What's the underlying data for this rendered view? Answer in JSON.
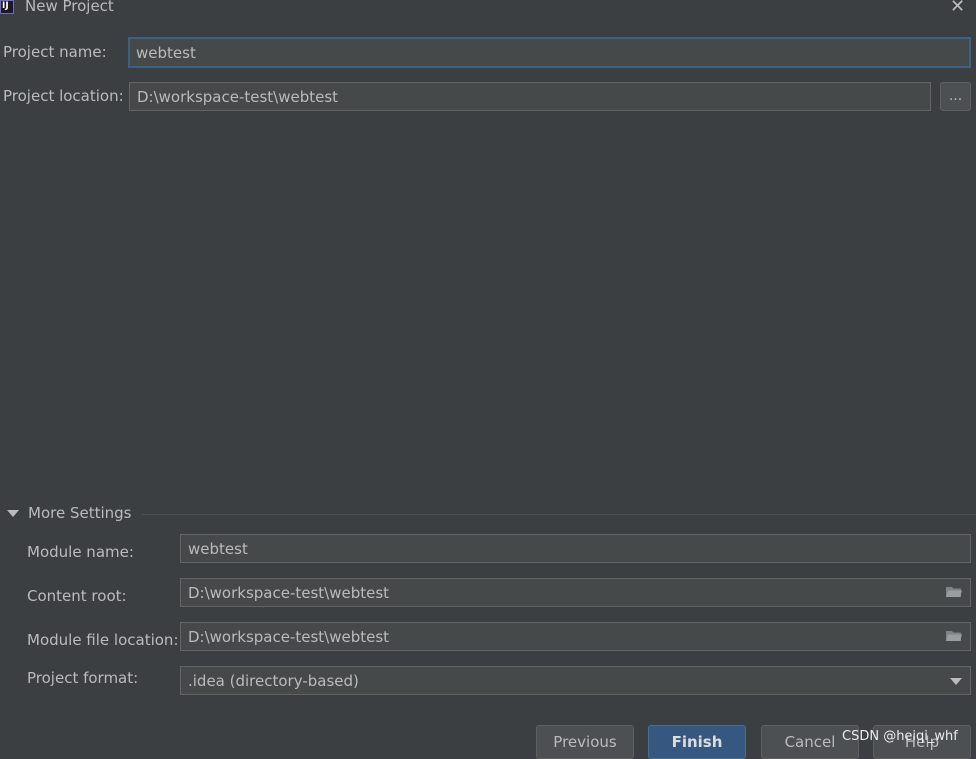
{
  "window": {
    "title": "New Project",
    "close_glyph": "✕",
    "app_icon_text": "IJ"
  },
  "project": {
    "name_label": "Project name:",
    "name_value": "webtest",
    "location_label": "Project location:",
    "location_value": "D:\\workspace-test\\webtest",
    "browse_label": "..."
  },
  "more_settings": {
    "header": "More Settings",
    "expanded": true,
    "module_name_label": "Module name:",
    "module_name_value": "webtest",
    "content_root_label": "Content root:",
    "content_root_value": "D:\\workspace-test\\webtest",
    "module_file_location_label": "Module file location:",
    "module_file_location_value": "D:\\workspace-test\\webtest",
    "project_format_label": "Project format:",
    "project_format_value": ".idea (directory-based)"
  },
  "buttons": {
    "previous": "Previous",
    "finish": "Finish",
    "cancel": "Cancel",
    "help": "Help"
  },
  "watermark": "CSDN @heiqi_whf",
  "icons": {
    "app": "intellij-icon",
    "close": "close-icon",
    "folder": "folder-icon",
    "dropdown": "chevron-down-icon",
    "collapse": "triangle-down-icon"
  },
  "colors": {
    "background": "#3c3f41",
    "field_bg": "#45494a",
    "focus_border": "#3d6185",
    "primary_button": "#365880",
    "text": "#bbbbbb"
  }
}
